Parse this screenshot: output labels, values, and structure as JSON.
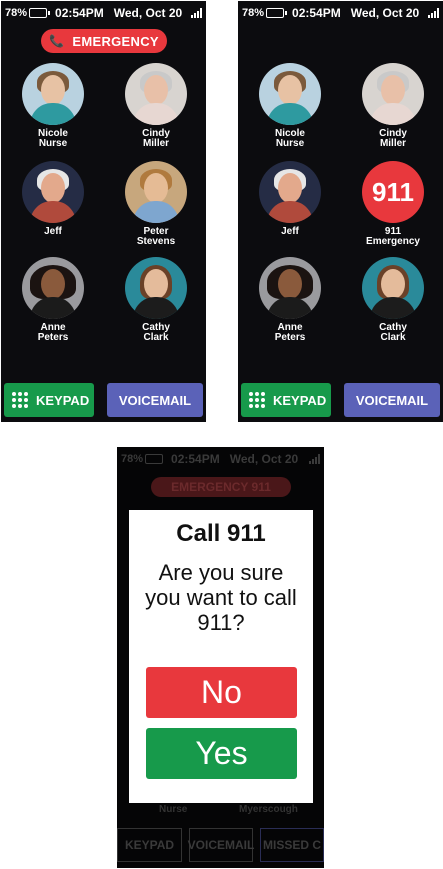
{
  "status": {
    "battery": "78%",
    "time": "02:54PM",
    "date": "Wed, Oct 20"
  },
  "screen1": {
    "emergency_label": "EMERGENCY",
    "contacts": [
      {
        "line1": "Nicole",
        "line2": "Nurse"
      },
      {
        "line1": "Cindy",
        "line2": "Miller"
      },
      {
        "line1": "Jeff",
        "line2": ""
      },
      {
        "line1": "Peter",
        "line2": "Stevens"
      },
      {
        "line1": "Anne",
        "line2": "Peters"
      },
      {
        "line1": "Cathy",
        "line2": "Clark"
      }
    ],
    "keypad_label": "KEYPAD",
    "voicemail_label": "VOICEMAIL"
  },
  "screen2": {
    "contacts": [
      {
        "line1": "Nicole",
        "line2": "Nurse"
      },
      {
        "line1": "Cindy",
        "line2": "Miller"
      },
      {
        "line1": "Jeff",
        "line2": ""
      },
      {
        "line1": "911",
        "line2": "Emergency"
      },
      {
        "line1": "Anne",
        "line2": "Peters"
      },
      {
        "line1": "Cathy",
        "line2": "Clark"
      }
    ],
    "emergency_circle_text": "911",
    "keypad_label": "KEYPAD",
    "voicemail_label": "VOICEMAIL"
  },
  "screen3": {
    "background_emergency_label": "EMERGENCY 911",
    "background_label_left": "Nurse",
    "background_label_right": "Myerscough",
    "background_buttons": [
      "KEYPAD",
      "VOICEMAIL",
      "MISSED C"
    ],
    "dialog": {
      "title": "Call 911",
      "message": "Are you sure you want to call 911?",
      "no_label": "No",
      "yes_label": "Yes"
    }
  },
  "colors": {
    "emergency_red": "#e8383d",
    "keypad_green": "#179a4b",
    "voicemail_purple": "#5b62b8",
    "screen_background": "#0c0c0f"
  }
}
